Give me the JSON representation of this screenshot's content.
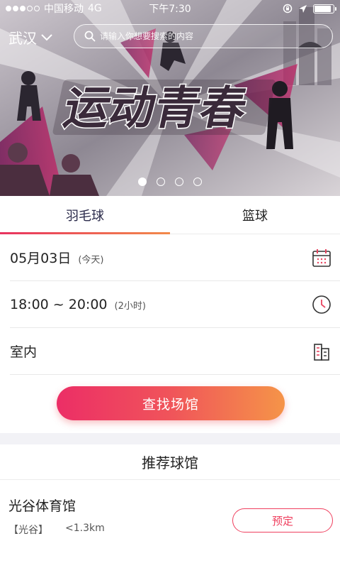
{
  "status_bar": {
    "carrier": "中国移动",
    "network": "4G",
    "time": "下午7:30",
    "signal_bars_filled": 3,
    "signal_bars_total": 5
  },
  "banner": {
    "city": "武汉",
    "search_placeholder": "请输入你想要搜索的内容",
    "page_count": 4,
    "active_page": 1
  },
  "tabs": [
    {
      "label": "羽毛球",
      "active": true
    },
    {
      "label": "篮球",
      "active": false
    }
  ],
  "form": {
    "date": "05月03日",
    "date_note": "(今天)",
    "time_range": "18:00 ~ 20:00",
    "duration": "(2小时)",
    "venue_type": "室内",
    "search_button": "查找场馆"
  },
  "recommend": {
    "title": "推荐球馆",
    "venues": [
      {
        "name": "光谷体育馆",
        "area": "【光谷】",
        "distance": "<1.3km",
        "book_label": "预定"
      }
    ]
  },
  "colors": {
    "accent_start": "#ec2e66",
    "accent_end": "#f59448",
    "book_border": "#ef3f5e"
  }
}
